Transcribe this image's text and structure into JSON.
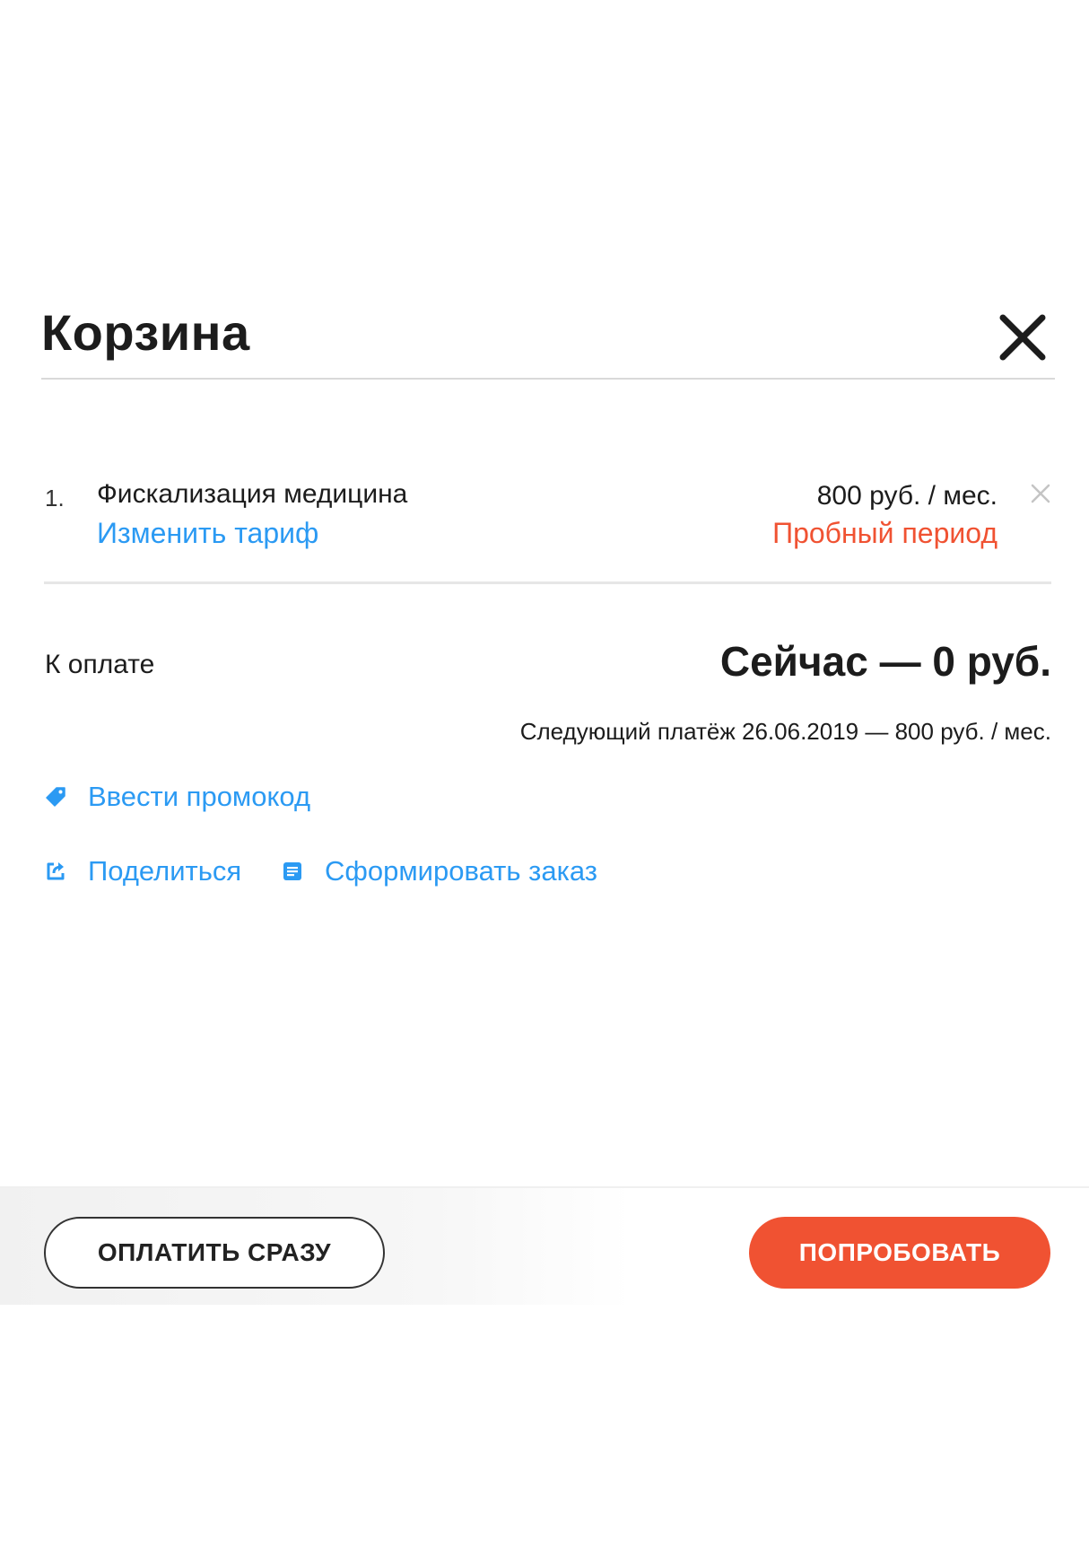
{
  "cart": {
    "title": "Корзина",
    "items": [
      {
        "number": "1.",
        "name": "Фискализация медицина",
        "change_tariff_label": "Изменить тариф",
        "price": "800 руб. / мес.",
        "status": "Пробный период"
      }
    ]
  },
  "payment": {
    "to_pay_label": "К оплате",
    "total_now": "Сейчас — 0 руб.",
    "next_payment": "Следующий платёж 26.06.2019 — 800 руб. / мес."
  },
  "links": {
    "promo": "Ввести промокод",
    "share": "Поделиться",
    "order": "Сформировать заказ"
  },
  "buttons": {
    "pay_now": "ОПЛАТИТЬ СРАЗУ",
    "try": "ПОПРОБОВАТЬ"
  },
  "icons": {
    "close": "close-icon",
    "remove": "remove-item-icon",
    "promo": "tag-icon",
    "share": "share-icon",
    "order": "document-icon"
  },
  "colors": {
    "accent_blue": "#2b9af3",
    "accent_orange": "#f05232",
    "text_dark": "#1c1c1c"
  }
}
